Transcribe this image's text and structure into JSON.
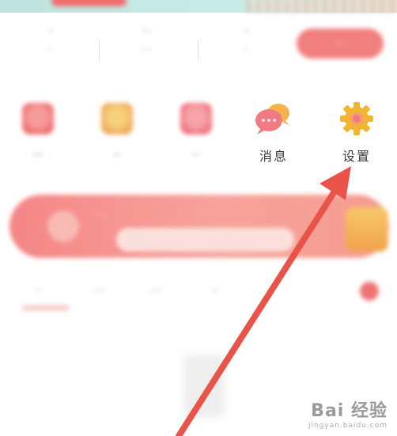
{
  "top_banner": {},
  "stats": {
    "items": [
      {
        "value": "··",
        "label": "··"
      },
      {
        "value": "···",
        "label": "····"
      },
      {
        "value": "··",
        "label": "··"
      }
    ],
    "open_button_label": "····"
  },
  "icons": {
    "blurred_labels": [
      "···",
      "··",
      "··"
    ],
    "messages_label": "消息",
    "settings_label": "设置"
  },
  "promo": {
    "text": "·····"
  },
  "tabs": {
    "items": [
      "··",
      "···",
      "···",
      "··"
    ]
  },
  "watermark": {
    "logo": "Bai  经验",
    "sub": "jingyan.baidu.com"
  },
  "colors": {
    "accent": "#f07a7a",
    "gear": "#f3b52f",
    "arrow": "#e8544a"
  }
}
